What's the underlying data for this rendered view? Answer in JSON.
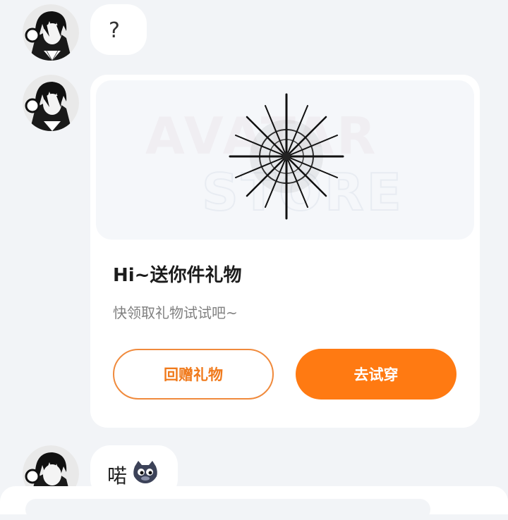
{
  "messages": {
    "first": {
      "text": "?"
    },
    "gift_card": {
      "banner_logo": "AVATAR STORE",
      "title": "Hi~送你件礼物",
      "subtitle": "快领取礼物试试吧~",
      "return_gift_label": "回赠礼物",
      "try_on_label": "去试穿"
    },
    "last": {
      "text": "喏"
    }
  },
  "colors": {
    "accent": "#ff7a12",
    "outline": "#f08a3c",
    "background": "#f2f4f7"
  },
  "icons": {
    "avatar": "avatar-portrait-icon",
    "emoji": "cat-face-icon"
  }
}
